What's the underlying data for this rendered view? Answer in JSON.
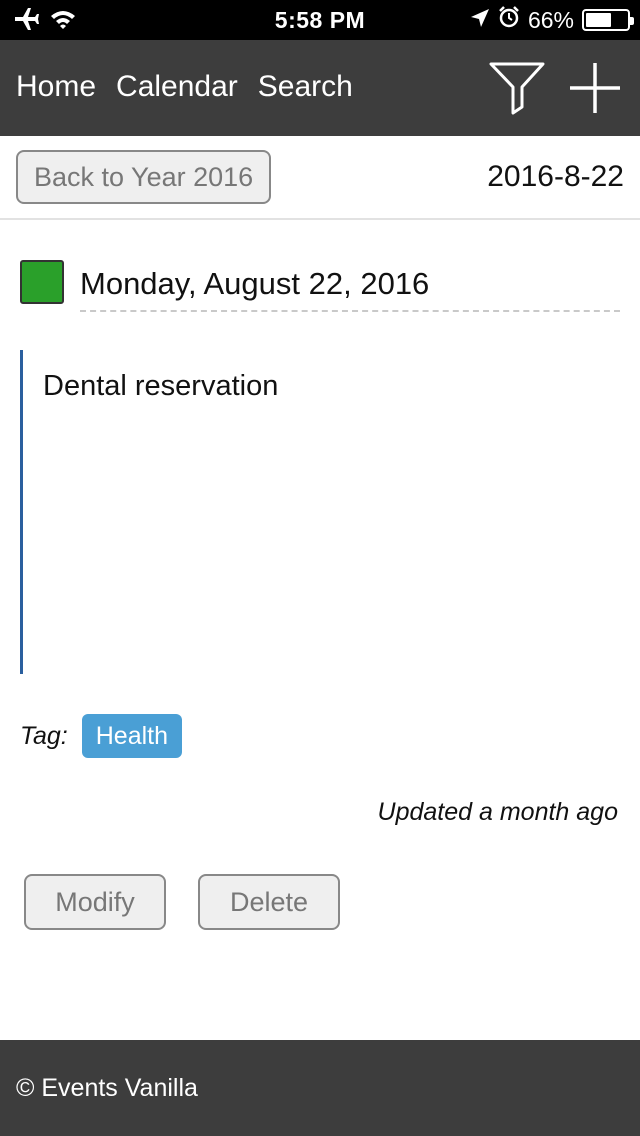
{
  "status_bar": {
    "time": "5:58 PM",
    "battery_text": "66%",
    "battery_level": 0.66,
    "icons": [
      "airplane-icon",
      "wifi-icon",
      "location-arrow-icon",
      "alarm-icon",
      "battery-icon"
    ]
  },
  "nav": {
    "links": [
      "Home",
      "Calendar",
      "Search"
    ],
    "icons": [
      "filter-icon",
      "plus-icon"
    ]
  },
  "subheader": {
    "back_label": "Back to Year 2016",
    "date_code": "2016-8-22"
  },
  "event": {
    "color": "#2aa02a",
    "date_long": "Monday, August 22, 2016",
    "description": "Dental reservation",
    "tag_label": "Tag:",
    "tag": "Health",
    "updated": "Updated a month ago"
  },
  "actions": {
    "modify_label": "Modify",
    "delete_label": "Delete"
  },
  "footer": {
    "text": "© Events Vanilla"
  },
  "colors": {
    "nav_bg": "#3d3d3d",
    "tag_bg": "#4a9fd5",
    "desc_border": "#2a5f9e"
  }
}
